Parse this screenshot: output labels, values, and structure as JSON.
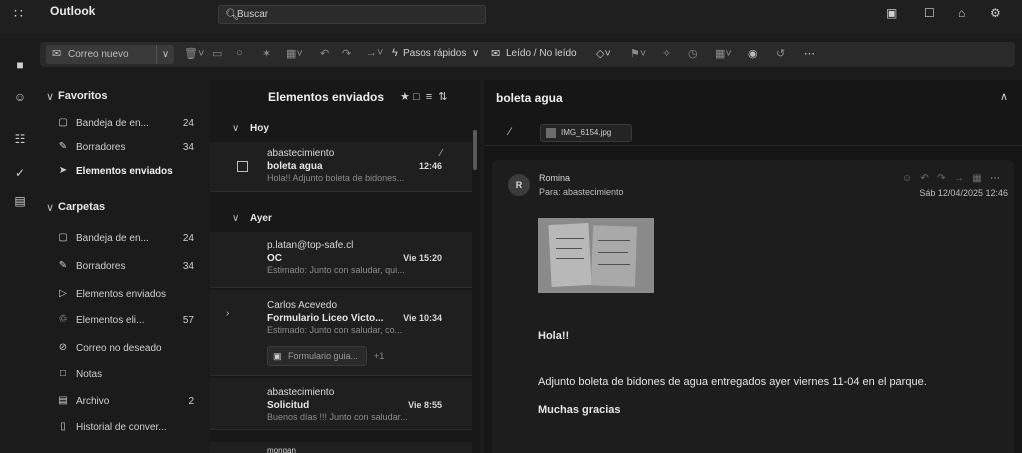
{
  "app": {
    "title": "Outlook"
  },
  "search": {
    "placeholder": "Buscar"
  },
  "ribbon": {
    "new_mail": "Correo nuevo",
    "quick_steps": "Pasos rápidos",
    "read_unread": "Leído / No leído"
  },
  "folders": {
    "favorites_header": "Favoritos",
    "favorites": [
      {
        "label": "Bandeja de en...",
        "count": "24",
        "icon": "inbox-icon"
      },
      {
        "label": "Borradores",
        "count": "34",
        "icon": "pencil-icon"
      },
      {
        "label": "Elementos enviados",
        "count": "",
        "icon": "send-icon",
        "selected": true
      }
    ],
    "folders_header": "Carpetas",
    "items": [
      {
        "label": "Bandeja de en...",
        "count": "24",
        "icon": "inbox-icon"
      },
      {
        "label": "Borradores",
        "count": "34",
        "icon": "pencil-icon"
      },
      {
        "label": "Elementos enviados",
        "count": "",
        "icon": "send-icon"
      },
      {
        "label": "Elementos eli...",
        "count": "57",
        "icon": "trash-icon"
      },
      {
        "label": "Correo no deseado",
        "count": "",
        "icon": "junk-icon"
      },
      {
        "label": "Notas",
        "count": "",
        "icon": "note-icon"
      },
      {
        "label": "Archivo",
        "count": "2",
        "icon": "archive-icon"
      },
      {
        "label": "Historial de conver...",
        "count": "",
        "icon": "history-icon"
      }
    ]
  },
  "list": {
    "title": "Elementos enviados",
    "groups": [
      {
        "label": "Hoy"
      },
      {
        "label": "Ayer"
      }
    ],
    "messages": [
      {
        "sender": "abastecimiento",
        "subject": "boleta agua",
        "time": "12:46",
        "preview": "Hola!! Adjunto boleta de bidones..."
      },
      {
        "sender": "p.latan@top-safe.cl",
        "subject": "OC",
        "time": "Vie 15:20",
        "preview": "Estimado: Junto con saludar, qui..."
      },
      {
        "sender": "Carlos Acevedo",
        "subject": "Formulario Liceo Victo...",
        "time": "Vie 10:34",
        "preview": "Estimado: Junto con saludar, co...",
        "attachment": "Formulario guia...",
        "attachment_more": "+1"
      },
      {
        "sender": "abastecimiento",
        "subject": "Solicitud",
        "time": "Vie 8:55",
        "preview": "Buenos días !!! Junto con saludar..."
      },
      {
        "sender": "mongan",
        "subject": "",
        "time": "",
        "preview": ""
      }
    ]
  },
  "reader": {
    "subject": "boleta agua",
    "attachment": "IMG_6154.jpg",
    "avatar": "R",
    "from": "Romina",
    "to": "Para: abastecimiento",
    "date": "Sáb 12/04/2025 12:46",
    "body": [
      "Hola!!",
      "Adjunto boleta de bidones de agua entregados ayer viernes 11-04 en el parque.",
      "Muchas gracias"
    ]
  }
}
